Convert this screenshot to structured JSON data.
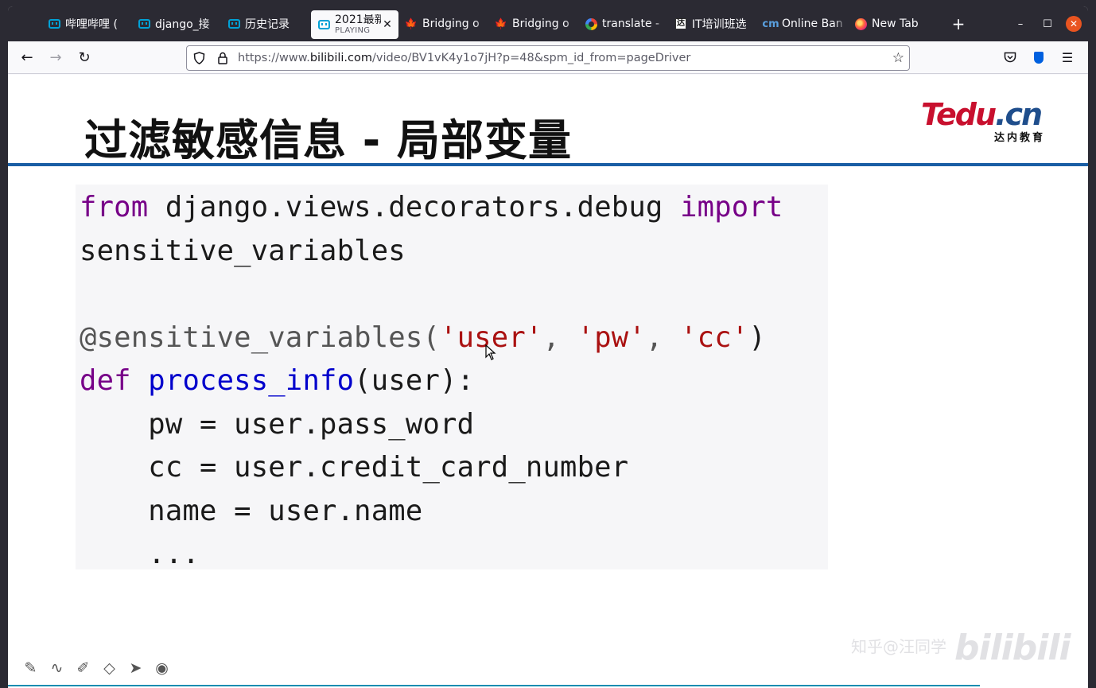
{
  "browser": {
    "tabs": [
      {
        "icon": "bilibili-icon",
        "label": "哔哩哔哩 ("
      },
      {
        "icon": "bilibili-icon",
        "label": "django_接"
      },
      {
        "icon": "bilibili-icon",
        "label": "历史记录"
      },
      {
        "icon": "bilibili-icon",
        "label": "2021最新",
        "sublabel": "PLAYING",
        "active": true
      },
      {
        "icon": "maple-leaf-icon",
        "label": "Bridging o"
      },
      {
        "icon": "maple-leaf-icon",
        "label": "Bridging o"
      },
      {
        "icon": "google-icon",
        "label": "translate -"
      },
      {
        "icon": "it-icon",
        "label": "IT培训班选"
      },
      {
        "icon": "cm-icon",
        "label": "Online Ban"
      },
      {
        "icon": "firefox-icon",
        "label": "New Tab"
      }
    ],
    "url_prefix": "https://www.",
    "url_domain": "bilibili.com",
    "url_rest": "/video/BV1vK4y1o7jH?p=48&spm_id_from=pageDriver"
  },
  "slide": {
    "title": "过滤敏感信息 - 局部变量",
    "logo_text_a": "Tedu",
    "logo_text_b": ".cn",
    "logo_sub": "达内教育",
    "code": {
      "line1_kw1": "from",
      "line1_mid": " django.views.decorators.debug ",
      "line1_kw2": "import",
      "line2": "sensitive_variables",
      "line4_dec": "@sensitive_variables(",
      "line4_s1": "'user'",
      "line4_sep1": ", ",
      "line4_s2": "'pw'",
      "line4_sep2": ", ",
      "line4_s3": "'cc'",
      "line4_end": ")",
      "line5_kw": "def",
      "line5_fn": "process_info",
      "line5_rest": "(user):",
      "line6": "    pw = user.pass_word",
      "line7": "    cc = user.credit_card_number",
      "line8": "    name = user.name",
      "line9": "    ..."
    }
  },
  "player": {
    "watermark_text": "知乎@汪同学",
    "watermark_logo": "bilibili",
    "progress": 0.9
  }
}
